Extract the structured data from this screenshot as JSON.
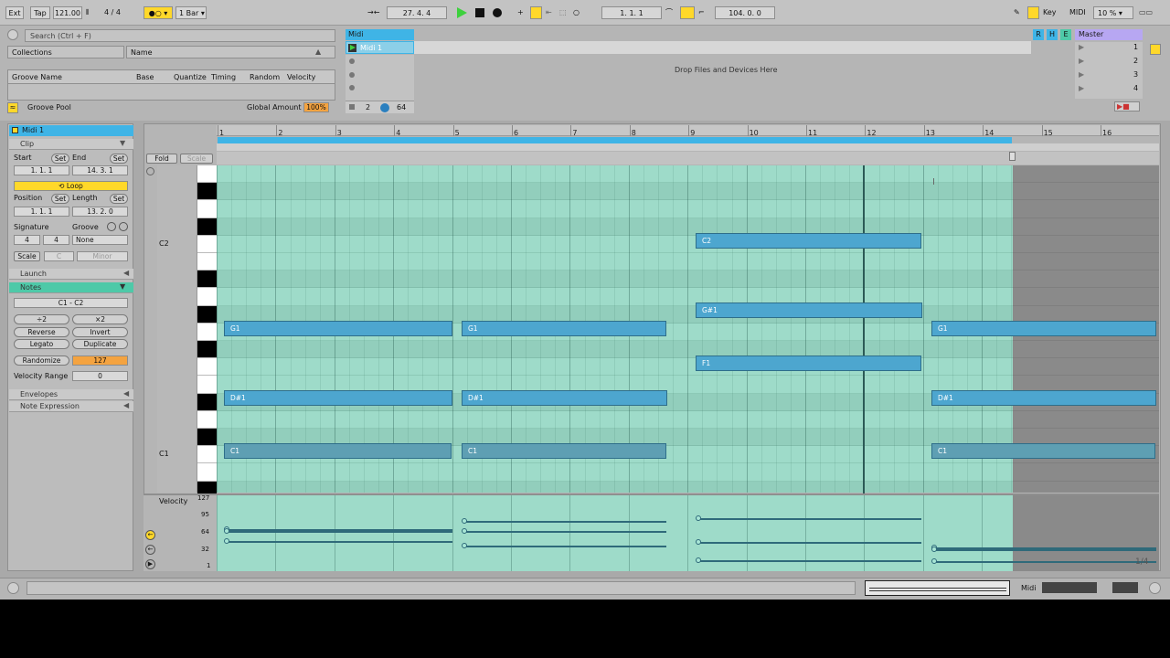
{
  "topbar": {
    "ext": "Ext",
    "tap": "Tap",
    "tempo": "121.00",
    "signature": "4 / 4",
    "quantize": "1 Bar",
    "position": "27.   4.   4",
    "loop_start": "1.   1.   1",
    "loop_length": "104.   0.   0",
    "key": "Key",
    "midi": "MIDI",
    "cpu": "10 %"
  },
  "browser": {
    "search_placeholder": "Search (Ctrl + F)",
    "collections": "Collections",
    "name_header": "Name"
  },
  "groove_pool": {
    "headers": [
      "Groove Name",
      "Base",
      "Quantize",
      "Timing",
      "Random",
      "Velocity"
    ],
    "title": "Groove Pool",
    "global_amount_label": "Global Amount",
    "global_amount": "100%"
  },
  "session": {
    "track_name": "Midi",
    "clip_name": "Midi 1",
    "drop_text": "Drop Files and Devices Here",
    "return_a": "R",
    "return_b": "H",
    "return_c": "E",
    "master": "Master",
    "master_slots": [
      "1",
      "2",
      "3",
      "4"
    ],
    "track_num": "2",
    "track_vol": "64"
  },
  "clip_view": {
    "clip_title": "Midi 1",
    "clip_section": "Clip",
    "start_label": "Start",
    "end_label": "End",
    "set_label": "Set",
    "start_value": "1.   1.   1",
    "end_value": "14.   3.   1",
    "loop_label": "Loop",
    "position_label": "Position",
    "length_label": "Length",
    "position_value": "1.   1.   1",
    "length_value": "13.   2.   0",
    "signature_label": "Signature",
    "groove_label": "Groove",
    "sig_num": "4",
    "sig_den": "4",
    "groove_value": "None",
    "scale_label": "Scale",
    "scale_root": "C",
    "scale_mode": "Minor",
    "launch_label": "Launch",
    "notes_label": "Notes",
    "note_range": "C1 - C2",
    "div2": "÷2",
    "mul2": "×2",
    "reverse": "Reverse",
    "invert": "Invert",
    "legato": "Legato",
    "duplicate": "Duplicate",
    "randomize": "Randomize",
    "randomize_value": "127",
    "velocity_range_label": "Velocity Range",
    "velocity_range_value": "0",
    "envelopes_label": "Envelopes",
    "note_expression_label": "Note Expression"
  },
  "editor": {
    "fold": "Fold",
    "scale": "Scale",
    "ruler": [
      "1",
      "2",
      "3",
      "4",
      "5",
      "6",
      "7",
      "8",
      "9",
      "10",
      "11",
      "12",
      "13",
      "14",
      "15",
      "16"
    ],
    "pitch_labels": [
      "C2",
      "C1"
    ],
    "notes": [
      {
        "name": "G1"
      },
      {
        "name": "G1"
      },
      {
        "name": "G1"
      },
      {
        "name": "D#1"
      },
      {
        "name": "D#1"
      },
      {
        "name": "D#1"
      },
      {
        "name": "C1"
      },
      {
        "name": "C1"
      },
      {
        "name": "C1"
      },
      {
        "name": "C2"
      },
      {
        "name": "G#1"
      },
      {
        "name": "F1"
      }
    ],
    "velocity_label": "Velocity",
    "velocity_ticks": [
      "127",
      "95",
      "64",
      "32",
      "1"
    ],
    "grid_readout": "1/4"
  },
  "statusbar": {
    "midi": "Midi"
  },
  "colors": {
    "accent_blue": "#3fb4e6",
    "note_fill": "#4da6cf",
    "grid_bg": "#9edbc9",
    "play_green": "#3dd13d",
    "highlight_orange": "#f4a340",
    "yellow": "#ffd82a"
  }
}
